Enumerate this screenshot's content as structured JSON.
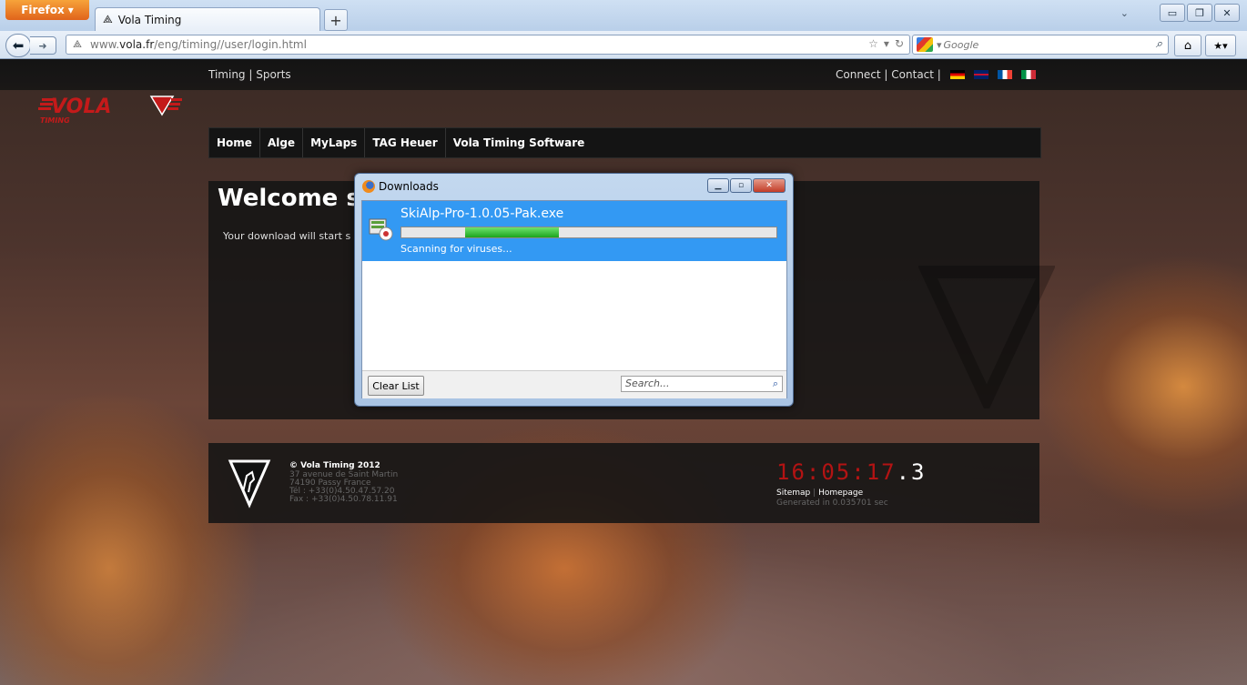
{
  "browser": {
    "menu_button": "Firefox",
    "tab_title": "Vola Timing",
    "new_tab": "+",
    "url_prefix": "www.",
    "url_domain": "vola.fr",
    "url_path": "/eng/timing//user/login.html",
    "search_placeholder": "Google"
  },
  "site": {
    "top_left_links": "Timing | Sports",
    "top_right_links": "Connect | Contact |",
    "flags": [
      {
        "name": "germany-flag",
        "colors": [
          "#000000",
          "#dd0000",
          "#ffce00"
        ]
      },
      {
        "name": "uk-flag",
        "colors": [
          "#012169",
          "#ffffff",
          "#c8102e"
        ]
      },
      {
        "name": "france-flag",
        "colors": [
          "#0055a4",
          "#ffffff",
          "#ef4135"
        ]
      },
      {
        "name": "italy-flag",
        "colors": [
          "#009246",
          "#ffffff",
          "#ce2b37"
        ]
      }
    ],
    "menu": [
      "Home",
      "Alge",
      "MyLaps",
      "TAG Heuer",
      "Vola Timing Software"
    ],
    "welcome": "Welcome s",
    "download_message": "Your download will start s",
    "footer": {
      "copyright": "© Vola Timing 2012",
      "address_line1": "37 avenue de Saint Martin",
      "address_line2": "74190 Passy France",
      "phone": "Tél : +33(0)4.50.47.57.20",
      "fax": "Fax : +33(0)4.50.78.11.91",
      "clock": "16:05:17",
      "clock_tenth": ".3",
      "sitemap": "Sitemap",
      "homepage": "Homepage",
      "generated": "Generated in 0.035701 sec"
    }
  },
  "downloads": {
    "title": "Downloads",
    "file_name": "SkiAlp-Pro-1.0.05-Pak.exe",
    "status": "Scanning for viruses...",
    "clear_list": "Clear List",
    "search_placeholder": "Search...",
    "progress_fill_start": 0.17,
    "progress_fill_end": 0.42
  },
  "colors": {
    "accent_red": "#b31313",
    "selection_blue": "#3399f3"
  }
}
